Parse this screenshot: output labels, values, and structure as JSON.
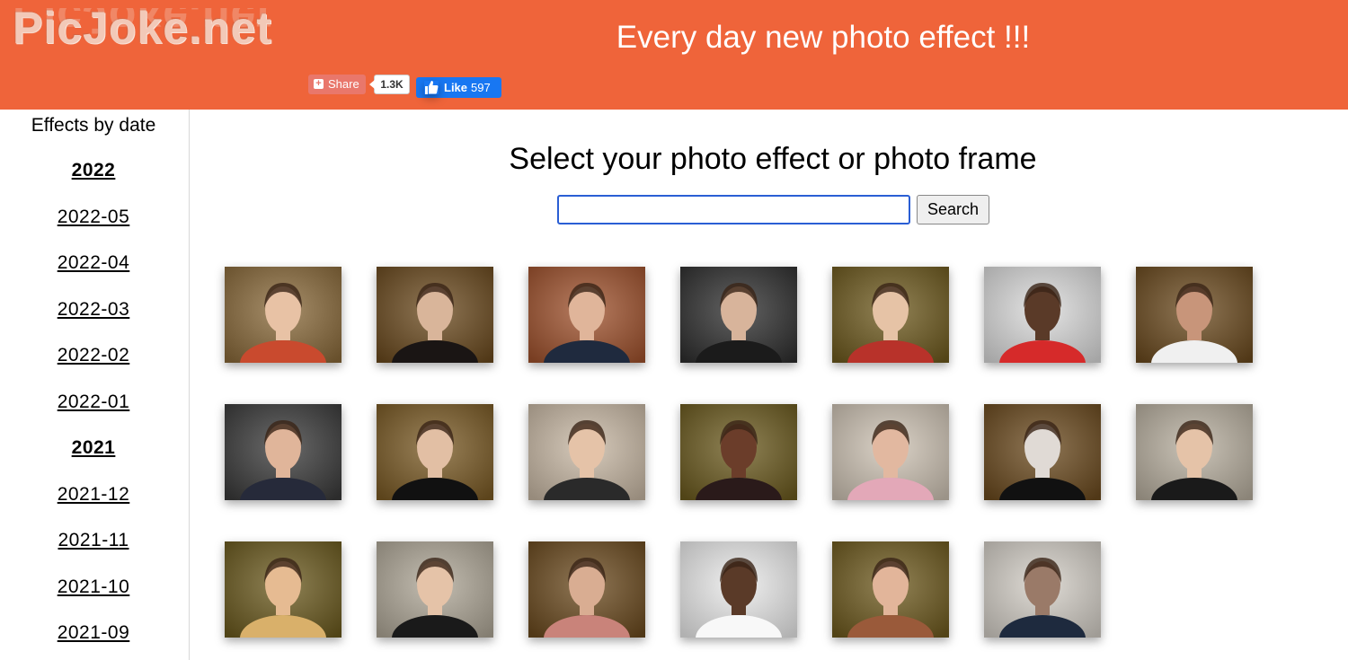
{
  "header": {
    "logo": "PicJoke.net",
    "tagline": "Every day new photo effect !!!",
    "share_label": "Share",
    "share_count": "1.3K",
    "like_label": "Like",
    "like_count": "597"
  },
  "sidebar": {
    "title": "Effects by date",
    "items": [
      "2022",
      "2022-05",
      "2022-04",
      "2022-03",
      "2022-02",
      "2022-01",
      "2021",
      "2021-12",
      "2021-11",
      "2021-10",
      "2021-09"
    ]
  },
  "main": {
    "title": "Select your photo effect or photo frame",
    "search_value": "",
    "search_button": "Search"
  },
  "colors": {
    "header_bg": "#ef643a",
    "link": "#000000"
  },
  "thumbnails": [
    {
      "name": "thumb-two-women-portrait",
      "bg": "#8a6a3a",
      "fg": "#e8c2a5",
      "acc": "#c94a2e"
    },
    {
      "name": "thumb-dark-hair-makeup",
      "bg": "#6b4a1e",
      "fg": "#d9b59a",
      "acc": "#1a1514"
    },
    {
      "name": "thumb-man-holding-photo",
      "bg": "#a0522d",
      "fg": "#e0b59a",
      "acc": "#1f2a3e"
    },
    {
      "name": "thumb-framed-portrait-man",
      "bg": "#2f2f2f",
      "fg": "#d8b49b",
      "acc": "#1b1b1b"
    },
    {
      "name": "thumb-blonde-woman",
      "bg": "#6e5a1e",
      "fg": "#e6c3a6",
      "acc": "#b8322a"
    },
    {
      "name": "thumb-woman-red-dress-gallery",
      "bg": "#dcdcdc",
      "fg": "#5a3a28",
      "acc": "#d62a2a"
    },
    {
      "name": "thumb-smiling-woman",
      "bg": "#6b4a1e",
      "fg": "#c8957a",
      "acc": "#f0f0f0"
    },
    {
      "name": "thumb-man-pointing-photo",
      "bg": "#3a3a3a",
      "fg": "#e0b59a",
      "acc": "#262a3a"
    },
    {
      "name": "thumb-young-man-suit",
      "bg": "#7a5a24",
      "fg": "#e2bfa4",
      "acc": "#111111"
    },
    {
      "name": "thumb-woman-with-frame",
      "bg": "#c9b9a5",
      "fg": "#e5c3a8",
      "acc": "#2a2a2a"
    },
    {
      "name": "thumb-smiling-woman-2",
      "bg": "#6b5a1e",
      "fg": "#6b3d2a",
      "acc": "#2a1a1a"
    },
    {
      "name": "thumb-man-pink-hoodie",
      "bg": "#cfc4b5",
      "fg": "#e2b8a0",
      "acc": "#e3a8b8"
    },
    {
      "name": "thumb-masked-figure",
      "bg": "#6b4a1e",
      "fg": "#e0dad5",
      "acc": "#111111"
    },
    {
      "name": "thumb-woman-striped-shirt",
      "bg": "#b9b0a0",
      "fg": "#e5c3a8",
      "acc": "#1a1a1a"
    },
    {
      "name": "thumb-blonde-smiling",
      "bg": "#6b5a1e",
      "fg": "#e6bb92",
      "acc": "#d9b06a"
    },
    {
      "name": "thumb-framed-portrait-old-man",
      "bg": "#b0a898",
      "fg": "#e5c3a8",
      "acc": "#1a1a1a"
    },
    {
      "name": "thumb-man-necklace",
      "bg": "#6b4a1e",
      "fg": "#d9ad92",
      "acc": "#c9837a"
    },
    {
      "name": "thumb-man-holding-frame",
      "bg": "#ececec",
      "fg": "#5a3a28",
      "acc": "#f8f8f8"
    },
    {
      "name": "thumb-auburn-woman",
      "bg": "#6e5a1e",
      "fg": "#e2b59a",
      "acc": "#9a5a3a"
    },
    {
      "name": "thumb-two-people-gallery",
      "bg": "#d5d0c8",
      "fg": "#9a7a68",
      "acc": "#1e2a3e"
    }
  ]
}
